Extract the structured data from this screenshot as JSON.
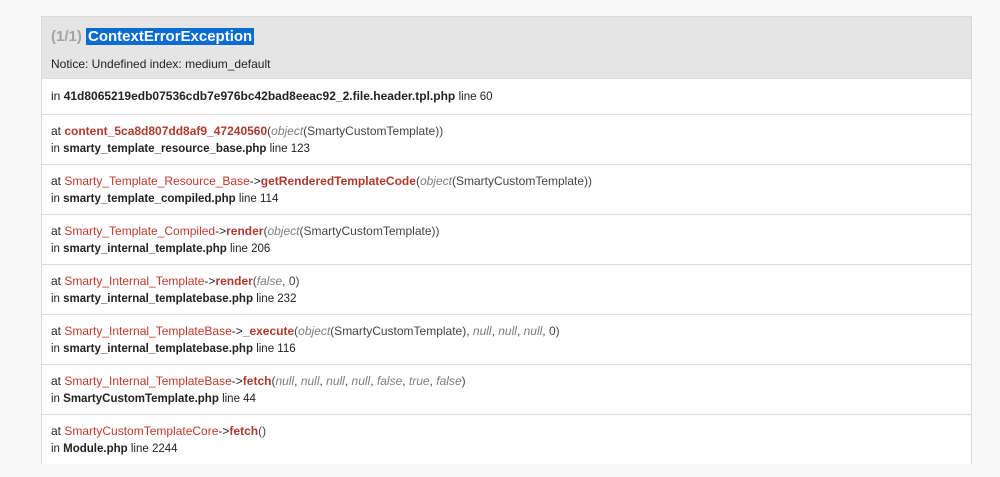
{
  "header": {
    "count": "(1/1)",
    "exception": "ContextErrorException",
    "message": "Notice: Undefined index: medium_default"
  },
  "first_location": {
    "in": "in",
    "file": "41d8065219edb07536cdb7e976bc42bad8eeac92_2.file.header.tpl.php",
    "line": "line 60"
  },
  "frames": [
    {
      "at": "at",
      "class": "",
      "arrow": "",
      "function": "content_5ca8d807dd8af9_47240560",
      "args_prefix": "(",
      "args_html": [
        {
          "t": "kw",
          "v": "object"
        },
        {
          "t": "plain",
          "v": "(SmartyCustomTemplate)"
        }
      ],
      "args_suffix": ")",
      "file": "smarty_template_resource_base.php",
      "line": "line 123"
    },
    {
      "at": "at",
      "class": "Smarty_Template_Resource_Base",
      "arrow": "->",
      "function": "getRenderedTemplateCode",
      "args_prefix": "(",
      "args_html": [
        {
          "t": "kw",
          "v": "object"
        },
        {
          "t": "plain",
          "v": "(SmartyCustomTemplate)"
        }
      ],
      "args_suffix": ")",
      "file": "smarty_template_compiled.php",
      "line": "line 114"
    },
    {
      "at": "at",
      "class": "Smarty_Template_Compiled",
      "arrow": "->",
      "function": "render",
      "args_prefix": "(",
      "args_html": [
        {
          "t": "kw",
          "v": "object"
        },
        {
          "t": "plain",
          "v": "(SmartyCustomTemplate)"
        }
      ],
      "args_suffix": ")",
      "file": "smarty_internal_template.php",
      "line": "line 206"
    },
    {
      "at": "at",
      "class": "Smarty_Internal_Template",
      "arrow": "->",
      "function": "render",
      "args_prefix": "(",
      "args_html": [
        {
          "t": "kw",
          "v": "false"
        },
        {
          "t": "plain",
          "v": ", 0"
        }
      ],
      "args_suffix": ")",
      "file": "smarty_internal_templatebase.php",
      "line": "line 232"
    },
    {
      "at": "at",
      "class": "Smarty_Internal_TemplateBase",
      "arrow": "->",
      "function": "_execute",
      "args_prefix": "(",
      "args_html": [
        {
          "t": "kw",
          "v": "object"
        },
        {
          "t": "plain",
          "v": "(SmartyCustomTemplate), "
        },
        {
          "t": "kw",
          "v": "null"
        },
        {
          "t": "plain",
          "v": ", "
        },
        {
          "t": "kw",
          "v": "null"
        },
        {
          "t": "plain",
          "v": ", "
        },
        {
          "t": "kw",
          "v": "null"
        },
        {
          "t": "plain",
          "v": ", 0"
        }
      ],
      "args_suffix": ")",
      "file": "smarty_internal_templatebase.php",
      "line": "line 116"
    },
    {
      "at": "at",
      "class": "Smarty_Internal_TemplateBase",
      "arrow": "->",
      "function": "fetch",
      "args_prefix": "(",
      "args_html": [
        {
          "t": "kw",
          "v": "null"
        },
        {
          "t": "plain",
          "v": ", "
        },
        {
          "t": "kw",
          "v": "null"
        },
        {
          "t": "plain",
          "v": ", "
        },
        {
          "t": "kw",
          "v": "null"
        },
        {
          "t": "plain",
          "v": ", "
        },
        {
          "t": "kw",
          "v": "null"
        },
        {
          "t": "plain",
          "v": ", "
        },
        {
          "t": "kw",
          "v": "false"
        },
        {
          "t": "plain",
          "v": ", "
        },
        {
          "t": "kw",
          "v": "true"
        },
        {
          "t": "plain",
          "v": ", "
        },
        {
          "t": "kw",
          "v": "false"
        }
      ],
      "args_suffix": ")",
      "file": "SmartyCustomTemplate.php",
      "line": "line 44"
    },
    {
      "at": "at",
      "class": "SmartyCustomTemplateCore",
      "arrow": "->",
      "function": "fetch",
      "args_prefix": "(",
      "args_html": [],
      "args_suffix": ")",
      "file": "Module.php",
      "line": "line 2244"
    }
  ],
  "colors": {
    "class": "#c0392b",
    "function": "#b03a2e",
    "highlight": "#0a6bd0"
  }
}
